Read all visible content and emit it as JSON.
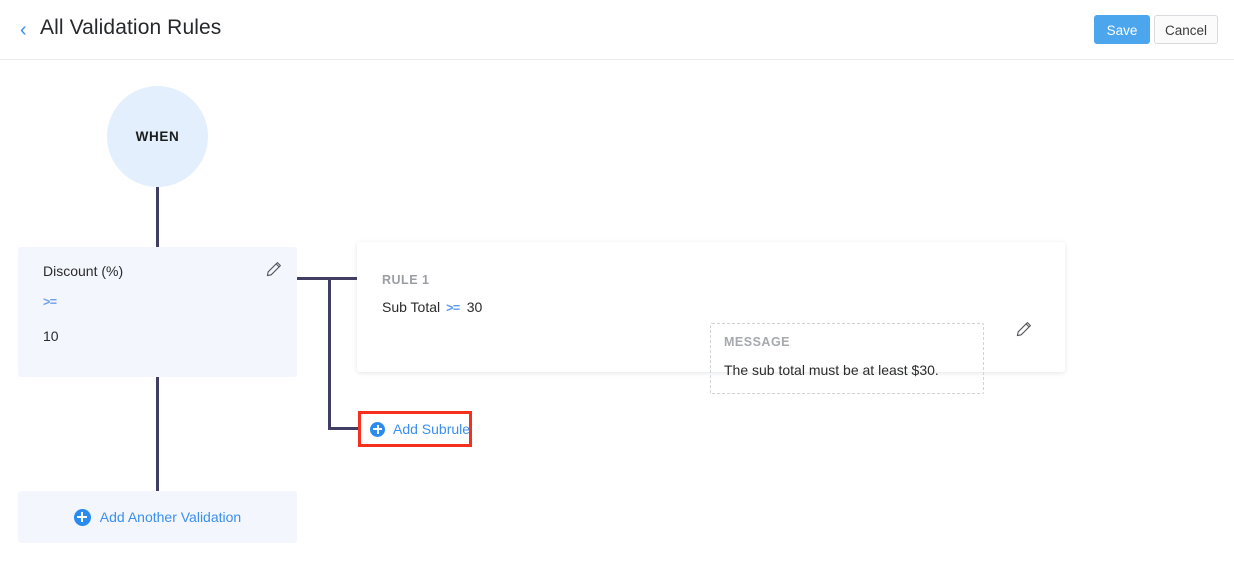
{
  "header": {
    "back_icon": "chevron-left-icon",
    "title": "All Validation Rules",
    "save_label": "Save",
    "cancel_label": "Cancel"
  },
  "flow": {
    "when_node_label": "WHEN",
    "criteria": {
      "field": "Discount (%)",
      "operator": ">=",
      "value": "10",
      "edit_icon": "pencil-icon"
    },
    "rule": {
      "title": "RULE 1",
      "expr_field": "Sub Total",
      "expr_operator": ">=",
      "expr_value": "30",
      "message_label": "MESSAGE",
      "message_text": "The sub total must be at least $30.",
      "edit_icon": "pencil-icon"
    },
    "add_subrule": {
      "label": "Add Subrule",
      "icon": "plus-circle-icon",
      "highlighted": true
    },
    "add_validation": {
      "label": "Add Another Validation",
      "icon": "plus-circle-icon"
    }
  },
  "colors": {
    "accent_blue": "#3b8ff0",
    "save_button": "#4ba6ee",
    "node_fill": "#e3effc",
    "card_fill": "#f3f6fd",
    "connector": "#413e63",
    "highlight_red": "#f5311d",
    "muted_label": "#9b9ea3"
  }
}
